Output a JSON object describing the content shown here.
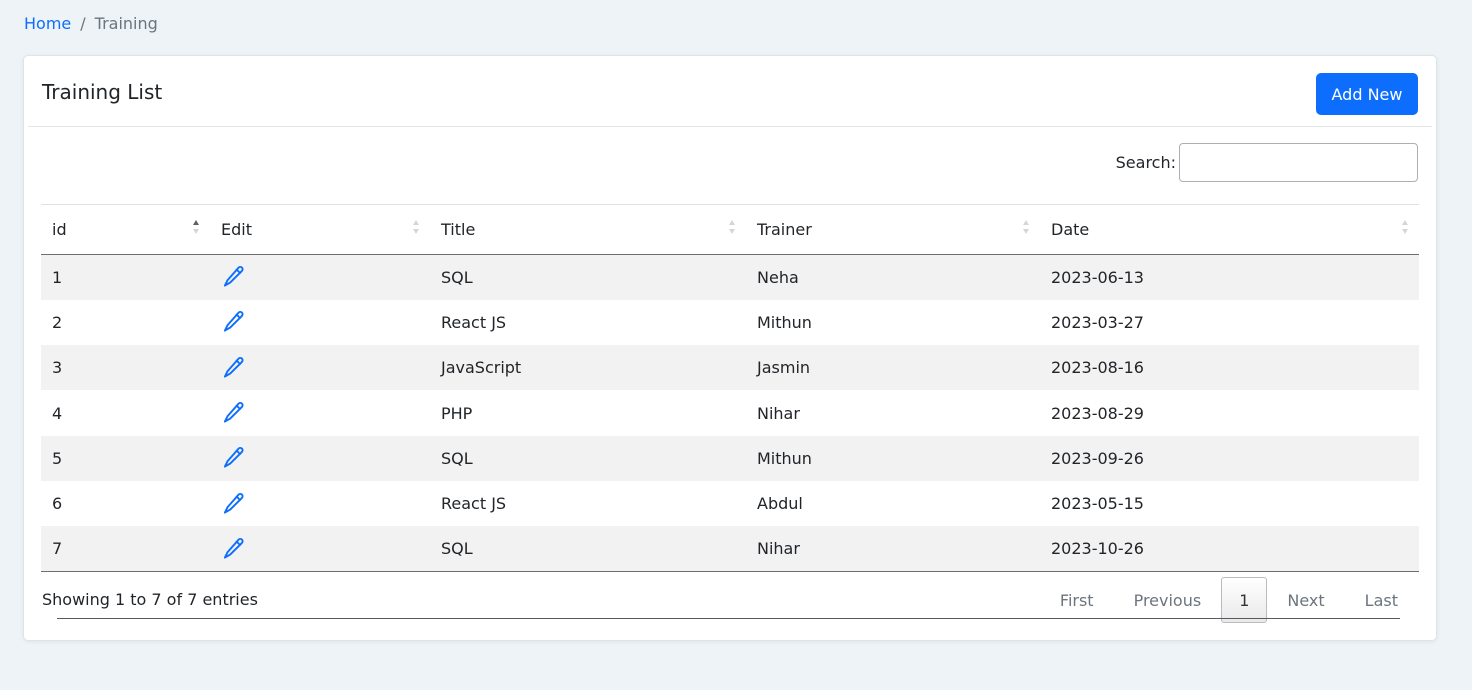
{
  "breadcrumb": {
    "home": "Home",
    "separator": "/",
    "current": "Training"
  },
  "card": {
    "title": "Training List",
    "add_button": "Add New"
  },
  "search": {
    "label": "Search:",
    "value": "",
    "placeholder": ""
  },
  "table": {
    "columns": [
      "id",
      "Edit",
      "Title",
      "Trainer",
      "Date"
    ],
    "sorted_column": "id",
    "sort_direction": "ascending",
    "rows": [
      {
        "id": "1",
        "title": "SQL",
        "trainer": "Neha",
        "date": "2023-06-13"
      },
      {
        "id": "2",
        "title": "React JS",
        "trainer": "Mithun",
        "date": "2023-03-27"
      },
      {
        "id": "3",
        "title": "JavaScript",
        "trainer": "Jasmin",
        "date": "2023-08-16"
      },
      {
        "id": "4",
        "title": "PHP",
        "trainer": "Nihar",
        "date": "2023-08-29"
      },
      {
        "id": "5",
        "title": "SQL",
        "trainer": "Mithun",
        "date": "2023-09-26"
      },
      {
        "id": "6",
        "title": "React JS",
        "trainer": "Abdul",
        "date": "2023-05-15"
      },
      {
        "id": "7",
        "title": "SQL",
        "trainer": "Nihar",
        "date": "2023-10-26"
      }
    ],
    "edit_icon": "pencil-icon"
  },
  "footer": {
    "info": "Showing 1 to 7 of 7 entries",
    "pagination": {
      "first": "First",
      "previous": "Previous",
      "current_page": "1",
      "next": "Next",
      "last": "Last"
    }
  },
  "colors": {
    "accent": "#0d6efd",
    "background": "#edf3f6",
    "stripe": "#f2f2f2"
  }
}
